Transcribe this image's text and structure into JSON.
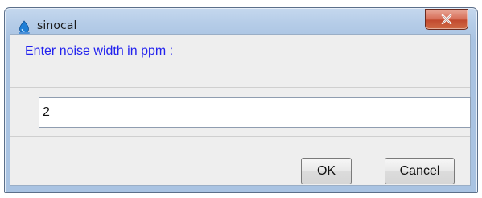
{
  "window": {
    "title": "sinocal",
    "app_icon": "sinocal-app-icon",
    "close_icon": "close-icon",
    "close_glyph": "✕",
    "colors": {
      "titlebar": "#b6cde8",
      "close_button": "#c24a2f",
      "prompt_text": "#2222ee"
    }
  },
  "dialog": {
    "prompt": "Enter noise width in ppm :",
    "input_value": "2",
    "ok_label": "OK",
    "cancel_label": "Cancel"
  }
}
